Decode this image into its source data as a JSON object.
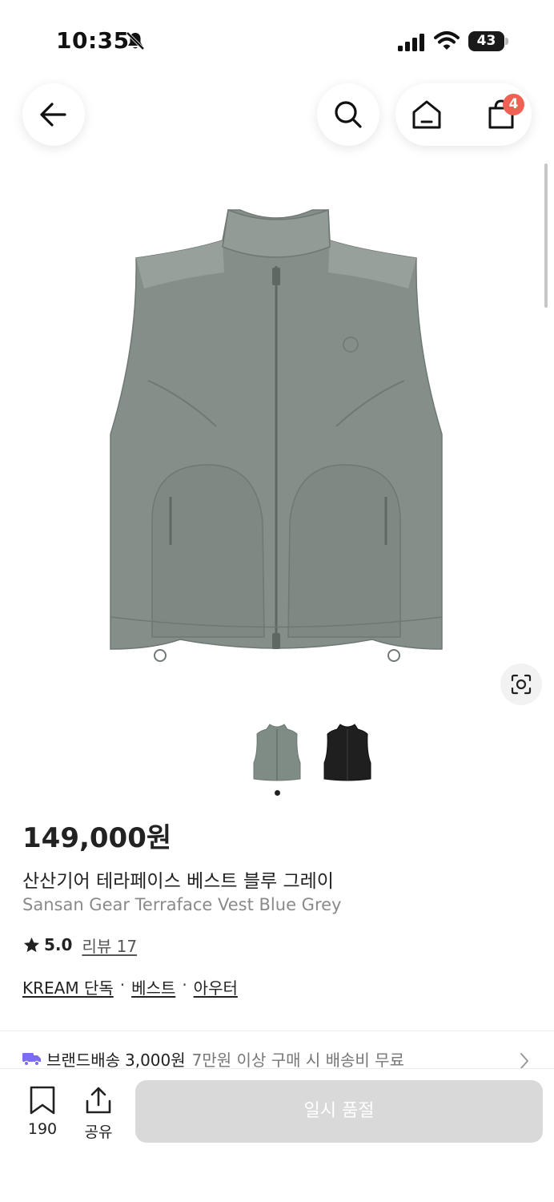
{
  "status_bar": {
    "time": "10:35",
    "battery": "43",
    "icons": [
      "bell-slash-icon",
      "cellular-signal-icon",
      "wifi-icon",
      "battery-icon"
    ]
  },
  "nav": {
    "icons": [
      "arrow-left-icon",
      "search-icon",
      "home-icon",
      "shopping-bag-icon"
    ],
    "cart_badge": "4"
  },
  "product": {
    "price": "149,000원",
    "name_ko": "산산기어 테라페이스 베스트 블루 그레이",
    "name_en": "Sansan Gear Terraface Vest Blue Grey",
    "rating": "5.0",
    "review_label": "리뷰 17",
    "tags": [
      "KREAM 단독",
      "베스트",
      "아우터"
    ],
    "tag_separator": "·",
    "image_slide": 1,
    "image_slides_total": 1
  },
  "thumbnails": [
    {
      "color": "#7f8c85",
      "icon": "vest-grey-thumbnail"
    },
    {
      "color": "#1f1f1f",
      "icon": "vest-black-thumbnail"
    }
  ],
  "delivery": {
    "label": "브랜드배송",
    "fee": "3,000원",
    "note": "7만원 이상 구매 시 배송비 무료"
  },
  "bottom_bar": {
    "bookmark_count": "190",
    "share_label": "공유",
    "soldout_label": "일시 품절"
  },
  "colors": {
    "vest": "#858f8a",
    "badge": "#ef6253",
    "truck": "#7b6cf0",
    "soldout_button": "#d9d9d9"
  }
}
